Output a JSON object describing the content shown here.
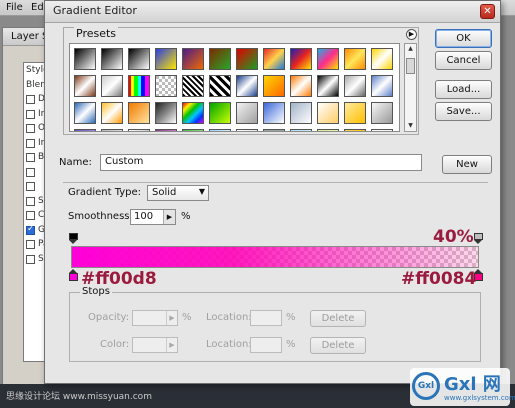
{
  "background": {
    "menubar": {
      "file": "File",
      "edit": "Edi"
    },
    "layer_style": {
      "title": "Layer St",
      "items": [
        {
          "label": "Styles",
          "check": false,
          "checked": false
        },
        {
          "label": "Blend",
          "check": false,
          "checked": false
        },
        {
          "label": "Dro",
          "check": true,
          "checked": false
        },
        {
          "label": "In",
          "check": true,
          "checked": false
        },
        {
          "label": "Ou",
          "check": true,
          "checked": false
        },
        {
          "label": "In",
          "check": true,
          "checked": false
        },
        {
          "label": "Be",
          "check": true,
          "checked": false
        },
        {
          "label": "",
          "check": true,
          "checked": false
        },
        {
          "label": "",
          "check": true,
          "checked": false
        },
        {
          "label": "Sa",
          "check": true,
          "checked": false
        },
        {
          "label": "Co",
          "check": true,
          "checked": false
        },
        {
          "label": "Gr",
          "check": true,
          "checked": true
        },
        {
          "label": "Pa",
          "check": true,
          "checked": false
        },
        {
          "label": "St",
          "check": true,
          "checked": false
        }
      ]
    },
    "bottom_text": "思缘设计论坛 www.missyuan.com",
    "watermark": {
      "circle": "Gxl",
      "big": "Gxl 网",
      "url": "www.gxlsystem.com"
    }
  },
  "dialog": {
    "title": "Gradient Editor",
    "presets_label": "Presets",
    "buttons": {
      "ok": "OK",
      "cancel": "Cancel",
      "load": "Load...",
      "save": "Save...",
      "new": "New"
    },
    "name_label": "Name:",
    "name_value": "Custom",
    "gradient_type_label": "Gradient Type:",
    "gradient_type_value": "Solid",
    "smoothness_label": "Smoothness:",
    "smoothness_value": "100",
    "smoothness_unit": "%",
    "opacity_annotation": "40%",
    "start_color_annotation": "#ff00d8",
    "end_color_annotation": "#ff0084",
    "stop_colors": {
      "start": "#ff00d8",
      "end": "#ff0084"
    },
    "stops": {
      "label": "Stops",
      "opacity_label": "Opacity:",
      "color_label": "Color:",
      "location_label": "Location:",
      "percent": "%",
      "delete_label": "Delete"
    }
  },
  "presets": [
    "linear-gradient(135deg,#000,#fff)",
    "linear-gradient(135deg,#000,transparent)",
    "linear-gradient(135deg,#000,#fff)",
    "linear-gradient(135deg,#2b3fe0,#ffe600)",
    "linear-gradient(135deg,#4b1b8a,#f06a00)",
    "linear-gradient(135deg,#7c2c00,#28a62a)",
    "linear-gradient(135deg,#e10000,#1a9f22)",
    "linear-gradient(135deg,#e42a2a,#ffd24a,#1e78d8)",
    "linear-gradient(135deg,#1b1fb6,#e62323,#ffe400)",
    "linear-gradient(135deg,#1fb0e4,#ff2a8c,#ffe600)",
    "linear-gradient(135deg,#ff8a00,#ffe65a,#ff8a00)",
    "linear-gradient(135deg,#ffd400,#fff,#ffd400)",
    "linear-gradient(135deg,#7d3b18,#fff,#7d3b18)",
    "linear-gradient(135deg,#ccc,#fff,#777)",
    "repeating-linear-gradient(90deg,#f00 0 10%,#ff0 10% 25%,#0f0 25% 45%,#0ff 45% 60%,#00f 60% 80%,#f0f 80% 100%)",
    "repeating-conic-gradient(#fff 0 25%,#bbb 0 50%) 0 0/6px 6px",
    "repeating-linear-gradient(45deg,#000 0 2px,#fff 2px 4px)",
    "repeating-linear-gradient(45deg,#000 0 3px,#fff 3px 6px)",
    "linear-gradient(135deg,#1a3e8a,#fff,#1a3e8a)",
    "linear-gradient(135deg,#ffd400,#ff6a00)",
    "linear-gradient(135deg,#ff7a00,#fff,#ff7a00)",
    "linear-gradient(135deg,#000,#fff,#000)",
    "linear-gradient(135deg,#aaa,#fff,#666)",
    "linear-gradient(135deg,#5d80c8,#fff,#5d80c8)",
    "linear-gradient(135deg,#2a68b8,#fff,#2a68b8)",
    "linear-gradient(135deg,#ffbe2a,#fff,#ff9a00)",
    "linear-gradient(135deg,#f17a00,#ffe3a0)",
    "linear-gradient(135deg,#222,#888,#fff)",
    "linear-gradient(135deg,#f40000,#ffef00,#00c400,#00c4ff,#0030ff,#f000ff)",
    "linear-gradient(135deg,#00a400,#c8ff00)",
    "linear-gradient(135deg,#f2f2f2,#a0a0a0)",
    "linear-gradient(135deg,#3a68d8,#ffffff)",
    "linear-gradient(135deg,#a2b3c8,#fff)",
    "linear-gradient(135deg,#fff,#ffcc66)",
    "linear-gradient(135deg,#ffeaa0,#ffc000)",
    "linear-gradient(135deg,#f7f7f7,#999)",
    "linear-gradient(135deg,#6e4ec0,#c9b7ff)",
    "linear-gradient(135deg,#b7b7b7,#fff)",
    "linear-gradient(135deg,#fff,#999)",
    "linear-gradient(135deg,#8b3b8b,#ffb3ff)",
    "linear-gradient(135deg,#4cb84c,#c8ffb0)",
    "linear-gradient(135deg,#98d6ff,#fff)",
    "linear-gradient(135deg,#fff,#ccc)",
    "linear-gradient(135deg,#97a8a8,#97a8a8)",
    "linear-gradient(135deg,#a9ddff,#e6f6ff)",
    "linear-gradient(135deg,#d8ec8c,#f4ffd0)",
    "linear-gradient(135deg,#ffd24a,#ffb400)",
    "linear-gradient(135deg,#fff,#e4e4e4)",
    "linear-gradient(135deg,#d0b2ff,#8a6be0)",
    "linear-gradient(135deg,#c6eb3a,#e7ff9a)",
    "linear-gradient(135deg,#c8c8c8,#9a9a9a)",
    "linear-gradient(135deg,#ff9ad8,#ff4fb0)",
    "linear-gradient(135deg,#ff8a00,#ffb000)",
    "linear-gradient(135deg,#d7d7d7,#bcbcbc)",
    "linear-gradient(135deg,#bfe0ff,#6ab8ff)",
    "linear-gradient(135deg,#ffe4b0,#ffc477)",
    "linear-gradient(135deg,#b6d2ff,#5f92ff)",
    "linear-gradient(135deg,#ffc800,#ffeb70)",
    "linear-gradient(135deg,#e40000,#ff3030)",
    "linear-gradient(135deg,#ffb0c8,#ffe0ea)",
    "linear-gradient(135deg,#e6e6e6,#ffffff)",
    "linear-gradient(135deg,#d40000,#ff2222)",
    "linear-gradient(135deg,#2d80ff,#7fb4ff)",
    "linear-gradient(135deg,#3ac4ff,#8ae2ff)",
    "linear-gradient(135deg,#ff0000,#c80000)"
  ]
}
